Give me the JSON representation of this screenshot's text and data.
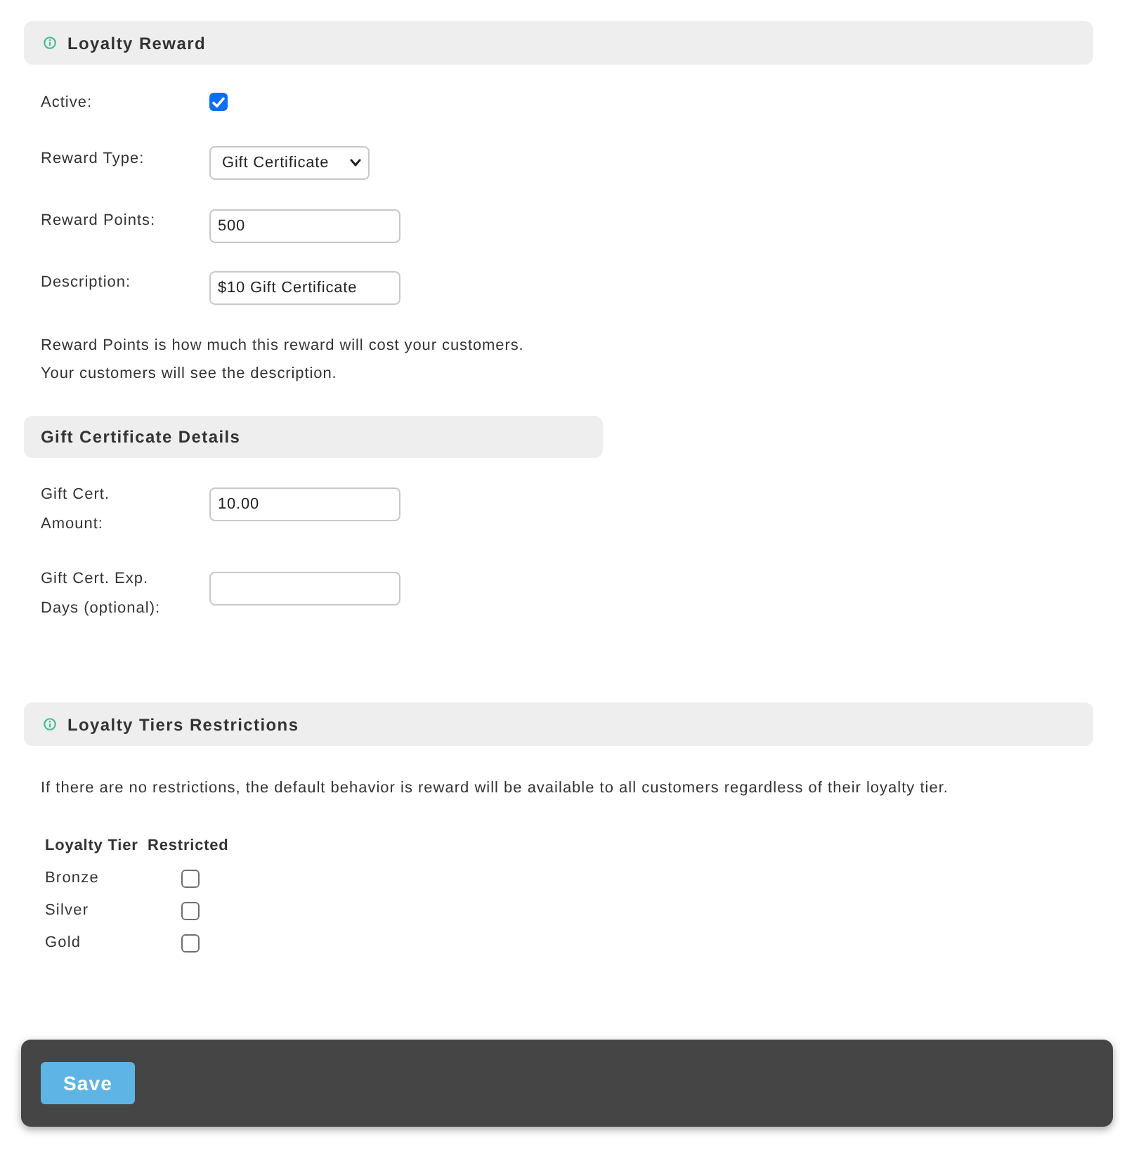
{
  "loyalty_reward": {
    "header": {
      "kind": "info",
      "title": "Loyalty Reward"
    },
    "fields": [
      {
        "kind": "checkbox",
        "label": "Active:",
        "checked": true
      },
      {
        "kind": "select",
        "label": "Reward Type:",
        "value": "Gift Certificate"
      },
      {
        "kind": "text",
        "label": "Reward Points:",
        "value": "500"
      },
      {
        "kind": "text",
        "label": "Description:",
        "value": "$10 Gift Certificate"
      }
    ],
    "help": [
      "Reward Points is how much this reward will cost your customers.",
      "Your customers will see the description."
    ]
  },
  "gift_certificate_details": {
    "header": {
      "kind": "plain",
      "title": "Gift Certificate Details"
    },
    "fields": [
      {
        "kind": "text",
        "label": "Gift Cert. Amount:",
        "value": "10.00"
      },
      {
        "kind": "text",
        "label": "Gift Cert. Exp. Days (optional):"
      }
    ]
  },
  "loyalty_tiers_restrictions": {
    "header": {
      "kind": "info",
      "title": "Loyalty Tiers Restrictions"
    },
    "note": "If there are no restrictions, the default behavior is reward will be available to all customers regardless of their loyalty tier.",
    "table": {
      "columns": [
        "Loyalty Tier",
        "Restricted"
      ],
      "rows": [
        {
          "tier": "Bronze",
          "restricted": false
        },
        {
          "tier": "Silver",
          "restricted": false
        },
        {
          "tier": "Gold",
          "restricted": false
        }
      ]
    }
  },
  "footer": {
    "buttons": [
      {
        "label": "Save"
      }
    ]
  }
}
